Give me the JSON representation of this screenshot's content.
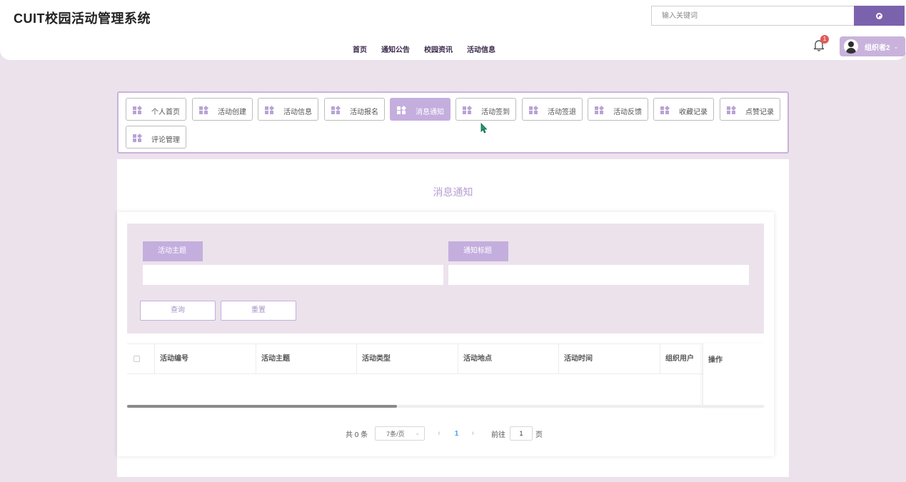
{
  "header": {
    "logo": "CUIT校园活动管理系统",
    "search_placeholder": "输入关键词",
    "nav": [
      "首页",
      "通知公告",
      "校园资讯",
      "活动信息"
    ],
    "notification_count": "1",
    "user_name": "组织者2",
    "user_caret": "⌄"
  },
  "menu": {
    "items": [
      "个人首页",
      "活动创建",
      "活动信息",
      "活动报名",
      "消息通知",
      "活动签到",
      "活动签退",
      "活动反馈",
      "收藏记录",
      "点赞记录",
      "评论管理"
    ],
    "active_index": 4
  },
  "panel": {
    "title": "消息通知",
    "filter": {
      "label_activity_theme": "活动主题",
      "label_notice_title": "通知标题",
      "activity_theme_value": "",
      "notice_title_value": "",
      "query_button": "查询",
      "reset_button": "重置"
    },
    "table": {
      "columns": [
        "活动编号",
        "活动主题",
        "活动类型",
        "活动地点",
        "活动时间",
        "组织用户"
      ],
      "action_column": "操作",
      "rows": []
    },
    "pagination": {
      "total": "共 0 条",
      "page_size": "7条/页",
      "prev": "‹",
      "current_page": "1",
      "next": "›",
      "goto_label": "前往",
      "goto_value": "1",
      "page_suffix": "页"
    }
  },
  "colors": {
    "accent": "#7b62ad",
    "menu_active": "#c4aede",
    "background": "#ece2ec",
    "title": "#b59fcf",
    "badge": "#e05a5a"
  }
}
